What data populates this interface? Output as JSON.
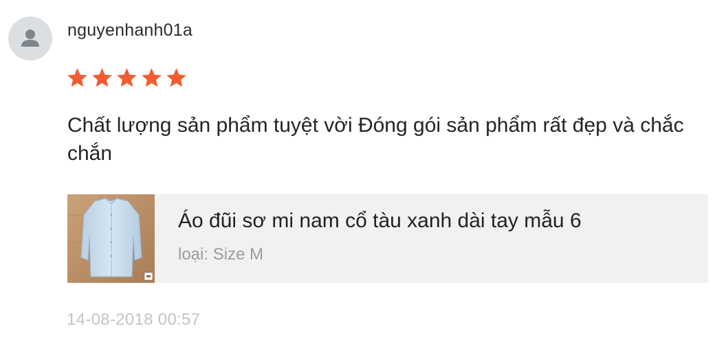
{
  "review": {
    "username": "nguyenhanh01a",
    "rating": 5,
    "max_rating": 5,
    "text": "Chất lượng sản phẩm tuyệt vời Đóng gói sản phẩm rất đẹp và chắc chắn",
    "timestamp": "14-08-2018 00:57"
  },
  "product": {
    "name": "Áo đũi sơ mi nam cổ tàu xanh dài tay mẫu 6",
    "variant": "loại: Size M"
  },
  "colors": {
    "star": "#f05d32",
    "avatar_bg": "#dcdfe2",
    "avatar_icon": "#7e868d",
    "card_bg": "#f1f1f1",
    "muted_text": "#9b9b9b",
    "timestamp_text": "#c4c4c4"
  },
  "icons": {
    "avatar": "user-silhouette-icon",
    "star": "star-filled-icon"
  }
}
